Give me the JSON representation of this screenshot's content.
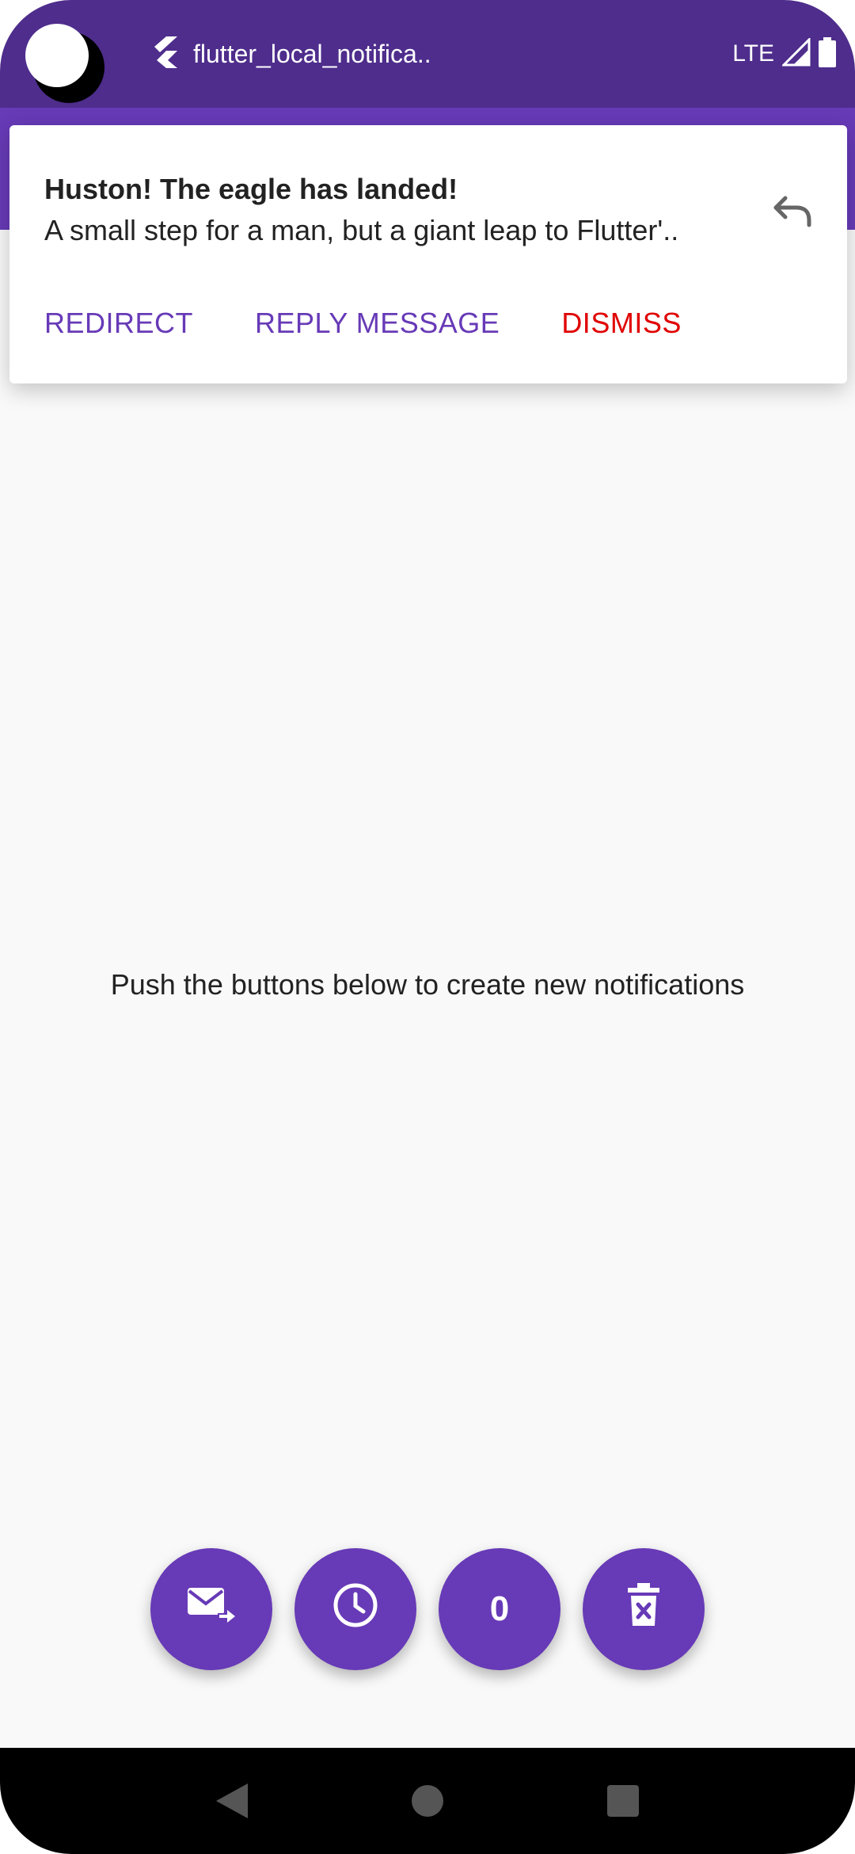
{
  "status_bar": {
    "app_title": "flutter_local_notifica..",
    "network": "LTE",
    "icons": [
      "flutter-icon",
      "signal-icon",
      "battery-icon"
    ]
  },
  "notification": {
    "title": "Huston! The eagle has landed!",
    "body": "A small step for a man, but a giant leap to Flutter'..",
    "icon": "reply-icon",
    "actions": [
      {
        "label": "REDIRECT"
      },
      {
        "label": "REPLY MESSAGE"
      },
      {
        "label": "DISMISS"
      }
    ]
  },
  "main": {
    "message": "Push the buttons below to create new notifications"
  },
  "fabs": {
    "items": [
      {
        "icon": "send-mail-icon"
      },
      {
        "icon": "schedule-clock-icon"
      },
      {
        "label": "0"
      },
      {
        "icon": "delete-trash-icon"
      }
    ]
  },
  "nav_bar": {
    "icons": [
      "back-icon",
      "home-icon",
      "recents-icon"
    ]
  },
  "colors": {
    "status_bar": "#4e2d8c",
    "primary": "#673ab7",
    "danger": "#e00000",
    "background": "#f9f9f9"
  }
}
